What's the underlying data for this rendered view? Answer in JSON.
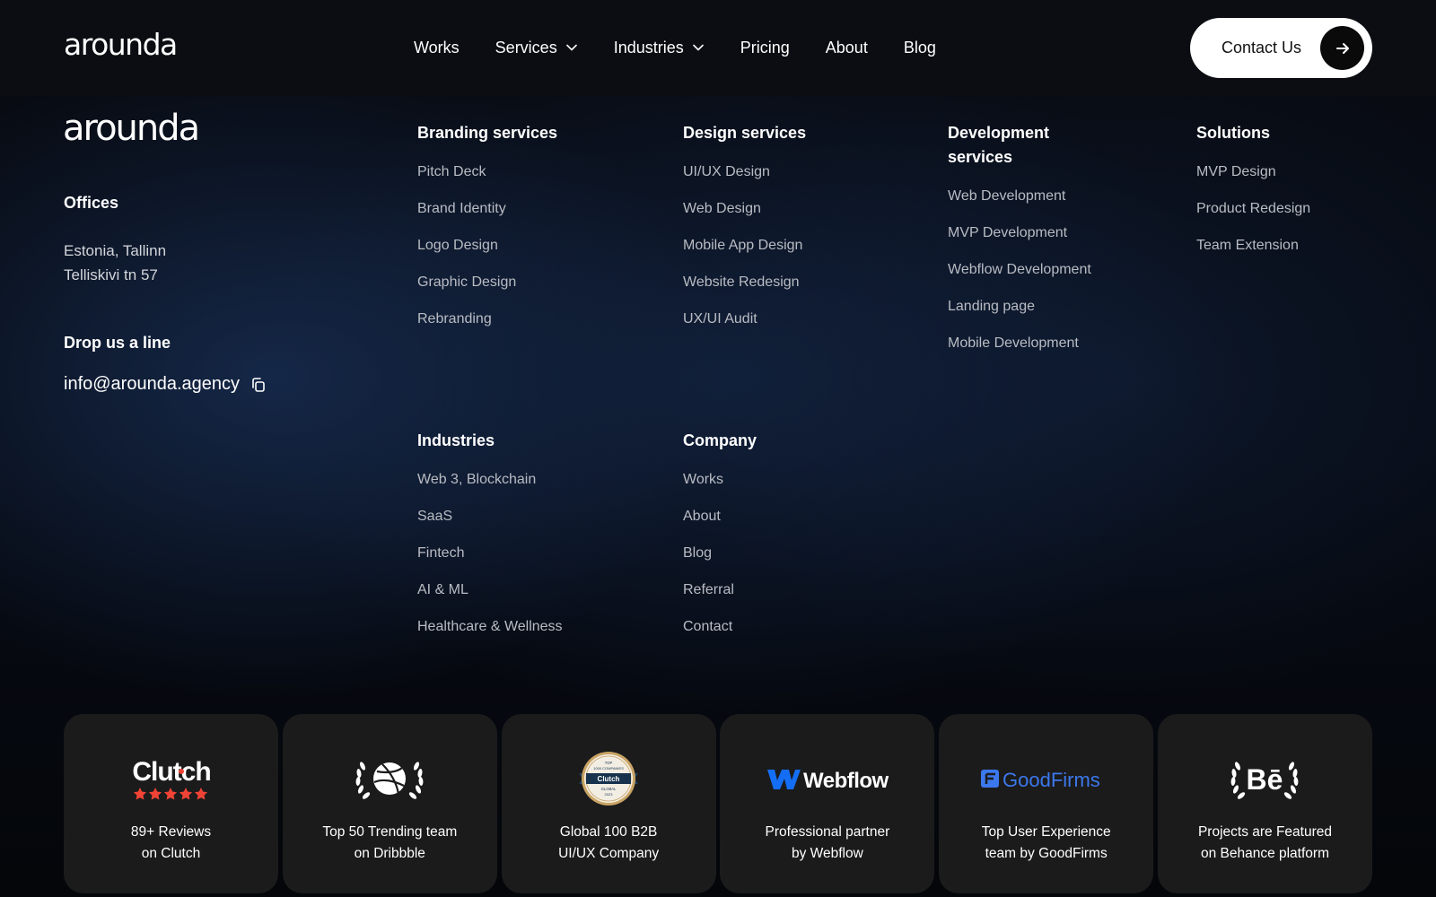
{
  "brand": {
    "name": "arounda"
  },
  "nav": {
    "items": [
      {
        "label": "Works",
        "dropdown": false
      },
      {
        "label": "Services",
        "dropdown": true
      },
      {
        "label": "Industries",
        "dropdown": true
      },
      {
        "label": "Pricing",
        "dropdown": false
      },
      {
        "label": "About",
        "dropdown": false
      },
      {
        "label": "Blog",
        "dropdown": false
      }
    ],
    "contact_label": "Contact Us"
  },
  "offices": {
    "title": "Offices",
    "line1": "Estonia, Tallinn",
    "line2": "Telliskivi tn 57"
  },
  "drop_line": {
    "title": "Drop us a line",
    "email": "info@arounda.agency"
  },
  "columns": {
    "branding": {
      "title": "Branding services",
      "links": [
        "Pitch Deck",
        "Brand Identity",
        "Logo Design",
        "Graphic Design",
        "Rebranding"
      ]
    },
    "design": {
      "title": "Design services",
      "links": [
        "UI/UX Design",
        "Web Design",
        "Mobile App Design",
        "Website Redesign",
        "UX/UI Audit"
      ]
    },
    "development": {
      "title_line1": "Development",
      "title_line2": "services",
      "links": [
        "Web Development",
        "MVP Development",
        "Webflow Development",
        "Landing page",
        "Mobile Development"
      ]
    },
    "solutions": {
      "title": "Solutions",
      "links": [
        "MVP Design",
        "Product Redesign",
        "Team Extension"
      ]
    },
    "industries": {
      "title": "Industries",
      "links": [
        "Web 3, Blockchain",
        "SaaS",
        "Fintech",
        "AI & ML",
        "Healthcare & Wellness"
      ]
    },
    "company": {
      "title": "Company",
      "links": [
        "Works",
        "About",
        "Blog",
        "Referral",
        "Contact"
      ]
    }
  },
  "badges": [
    {
      "icon": "clutch-logo",
      "logo_text": "Clutch",
      "line1": "89+ Reviews",
      "line2": "on Clutch"
    },
    {
      "icon": "dribbble-laurel-icon",
      "line1": "Top 50 Trending team",
      "line2": "on Dribbble"
    },
    {
      "icon": "clutch-global-seal",
      "seal_text": [
        "TOP",
        "1000 COMPANIES",
        "Clutch",
        "GLOBAL",
        "2023"
      ],
      "line1": "Global 100 B2B",
      "line2": "UI/UX Company"
    },
    {
      "icon": "webflow-logo",
      "logo_text": "Webflow",
      "line1": "Professional partner",
      "line2": "by Webflow"
    },
    {
      "icon": "goodfirms-logo",
      "logo_text": "GoodFirms",
      "line1": "Top User Experience",
      "line2": "team by GoodFirms"
    },
    {
      "icon": "behance-laurel-icon",
      "logo_text": "Bē",
      "line1": "Projects are Featured",
      "line2": "on Behance platform"
    }
  ],
  "colors": {
    "background": "#070b14",
    "header": "#0b0d12",
    "badge_card": "#1b1b1c",
    "link_text": "#b9bcc3",
    "clutch_red": "#ef4335",
    "webflow_blue": "#146ef5",
    "goodfirms_blue": "#3c78ec"
  }
}
